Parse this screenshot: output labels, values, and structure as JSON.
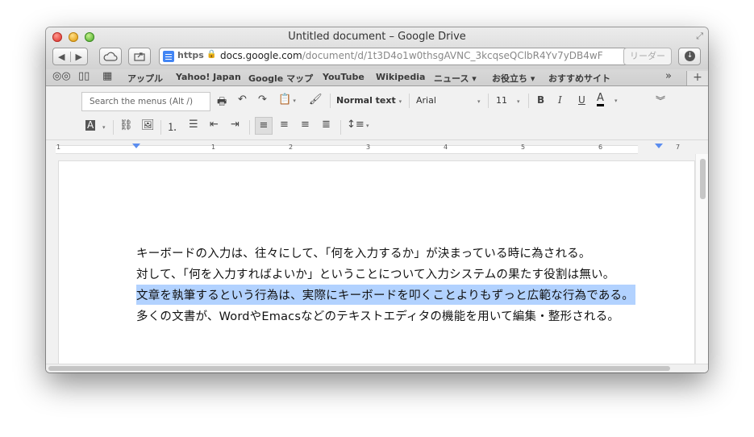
{
  "window": {
    "title": "Untitled document – Google Drive"
  },
  "toolbar": {
    "back": "◀",
    "forward": "▶",
    "url": {
      "scheme": "https",
      "host": "docs.google.com",
      "path": "/document/d/1t3D4o1w0thsgAVNC_3kcqseQClbR4Yv7yDB4wF"
    },
    "reader_label": "リーダー"
  },
  "bookmarks": [
    "アップル",
    "Yahoo! Japan",
    "Google マップ",
    "YouTube",
    "Wikipedia",
    "ニュース ▾",
    "お役立ち ▾",
    "おすすめサイト"
  ],
  "docs_toolbar": {
    "search_menus_placeholder": "Search the menus (Alt /)",
    "style": "Normal text",
    "font": "Arial",
    "size": "11",
    "bold": "B",
    "italic": "I",
    "underline": "U",
    "text_color": "A"
  },
  "ruler_numbers": [
    "1",
    "1",
    "2",
    "3",
    "4",
    "5",
    "6",
    "7"
  ],
  "document": {
    "lines": [
      "キーボードの入力は、往々にして、「何を入力するか」が決まっている時に為される。",
      "対して、「何を入力すればよいか」ということについて入力システムの果たす役割は無い。",
      "文章を執筆するという行為は、実際にキーボードを叩くことよりもずっと広範な行為である。",
      "多くの文書が、WordやEmacsなどのテキストエディタの機能を用いて編集・整形される。"
    ],
    "selected_line_index": 2
  }
}
